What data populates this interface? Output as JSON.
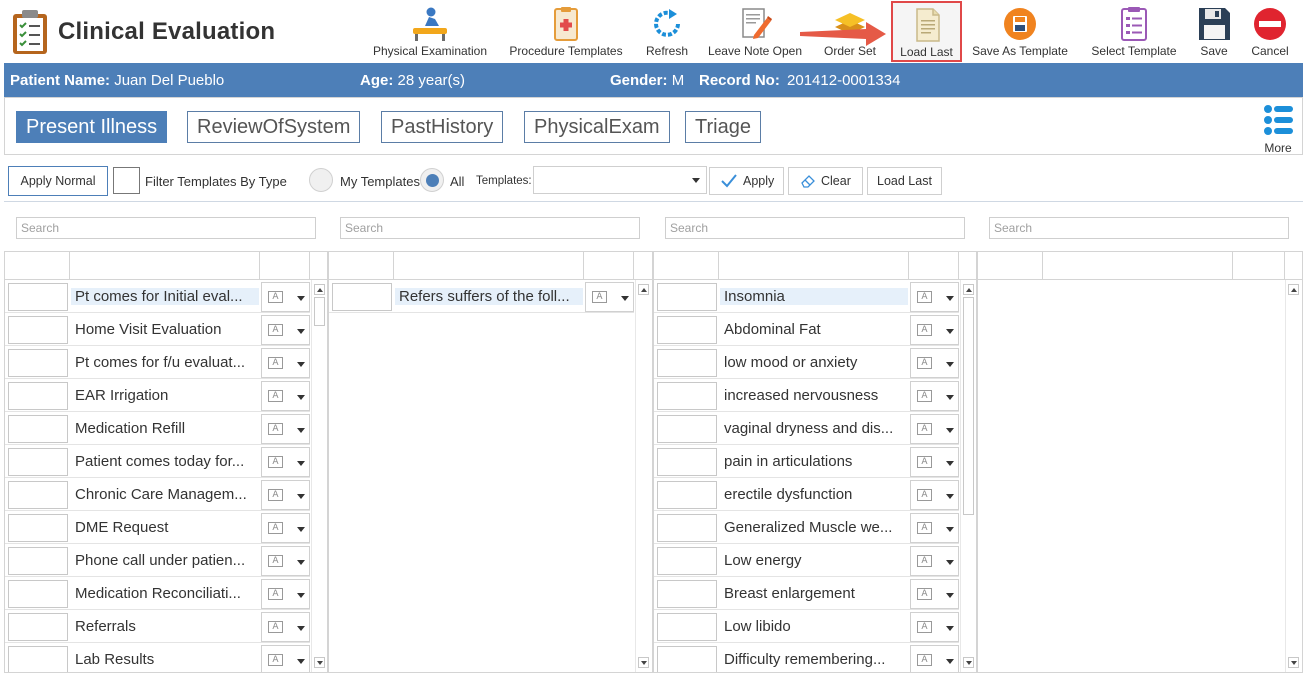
{
  "header": {
    "title": "Clinical Evaluation",
    "toolbar": [
      {
        "label": "Physical Examination",
        "icon": "physical-exam-icon"
      },
      {
        "label": "Procedure Templates",
        "icon": "procedure-template-icon"
      },
      {
        "label": "Refresh",
        "icon": "refresh-icon"
      },
      {
        "label": "Leave Note Open",
        "icon": "edit-note-icon"
      },
      {
        "label": "Order Set",
        "icon": "layers-icon"
      },
      {
        "label": "Load Last",
        "icon": "document-icon"
      },
      {
        "label": "Save As Template",
        "icon": "save-template-icon"
      },
      {
        "label": "Select Template",
        "icon": "checklist-icon"
      },
      {
        "label": "Save",
        "icon": "floppy-icon"
      },
      {
        "label": "Cancel",
        "icon": "no-entry-icon"
      }
    ]
  },
  "patient": {
    "name_label": "Patient Name:",
    "name": "Juan Del Pueblo",
    "age_label": "Age:",
    "age": "28 year(s)",
    "gender_label": "Gender:",
    "gender": "M",
    "record_label": "Record No:",
    "record": "201412-0001334"
  },
  "tabs": [
    "Present Illness",
    "ReviewOfSystem",
    "PastHistory",
    "PhysicalExam",
    "Triage"
  ],
  "more_label": "More",
  "actions": {
    "apply_normal": "Apply Normal",
    "filter_label": "Filter Templates By Type",
    "my_templates": "My Templates",
    "all": "All",
    "templates_label": "Templates:",
    "apply": "Apply",
    "clear": "Clear",
    "load_last": "Load Last"
  },
  "search_placeholder": "Search",
  "grid1": [
    "Pt comes for Initial eval...",
    "Home Visit Evaluation",
    "Pt comes for f/u evaluat...",
    "EAR Irrigation",
    "Medication Refill",
    "Patient comes today for...",
    "Chronic Care Managem...",
    "DME Request",
    "Phone call under patien...",
    "Medication Reconciliati...",
    "Referrals",
    "Lab Results"
  ],
  "grid2": [
    "Refers suffers of the foll..."
  ],
  "grid3": [
    "Insomnia",
    "Abdominal Fat",
    "low mood or anxiety",
    "increased nervousness",
    "vaginal dryness and dis...",
    "pain in articulations",
    "erectile dysfunction",
    "Generalized Muscle we...",
    "Low energy",
    "Breast enlargement",
    "Low libido",
    "Difficulty remembering..."
  ],
  "colors": {
    "accent": "#4d7fb8",
    "highlight": "#e04848"
  }
}
